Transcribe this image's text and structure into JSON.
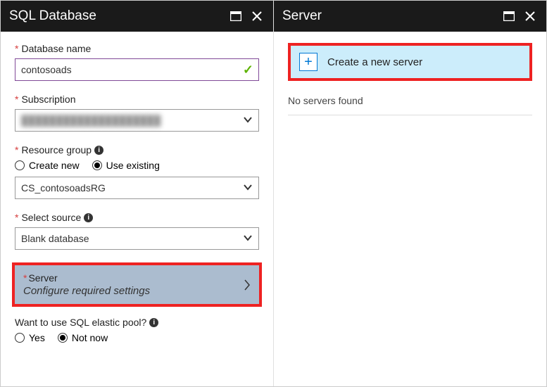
{
  "left": {
    "title": "SQL Database",
    "database_name_label": "Database name",
    "database_name_value": "contosoads",
    "subscription_label": "Subscription",
    "subscription_value": "████████████████████",
    "resource_group_label": "Resource group",
    "rg_create_new": "Create new",
    "rg_use_existing": "Use existing",
    "rg_value": "CS_contosoadsRG",
    "select_source_label": "Select source",
    "select_source_value": "Blank database",
    "server_label": "Server",
    "server_sub": "Configure required settings",
    "elastic_label": "Want to use SQL elastic pool?",
    "elastic_yes": "Yes",
    "elastic_no": "Not now"
  },
  "right": {
    "title": "Server",
    "create_label": "Create a new server",
    "empty": "No servers found"
  }
}
